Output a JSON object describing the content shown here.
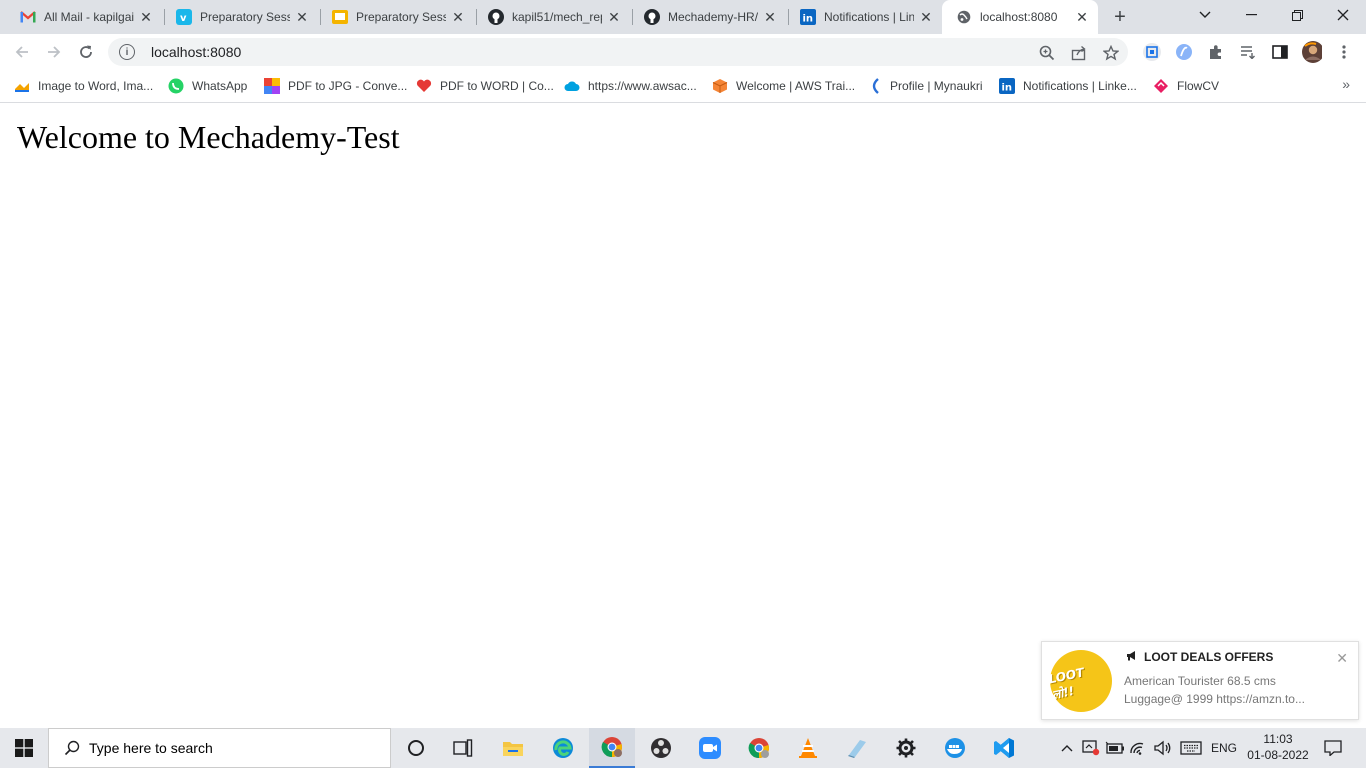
{
  "browser": {
    "tabs": [
      {
        "title": "All Mail - kapilgai",
        "icon": "gmail-icon"
      },
      {
        "title": "Preparatory Sessi",
        "icon": "vimeo-icon"
      },
      {
        "title": "Preparatory Sessi",
        "icon": "slides-icon"
      },
      {
        "title": "kapil51/mech_rep",
        "icon": "github-icon"
      },
      {
        "title": "Mechademy-HR/",
        "icon": "github-icon"
      },
      {
        "title": "Notifications | Lin",
        "icon": "linkedin-icon"
      },
      {
        "title": "localhost:8080",
        "icon": "globe-icon",
        "active": true
      }
    ],
    "url": "localhost:8080",
    "bookmarks": [
      {
        "label": "Image to Word, Ima...",
        "icon": "hand-icon"
      },
      {
        "label": "WhatsApp",
        "icon": "whatsapp-icon"
      },
      {
        "label": "PDF to JPG - Conve...",
        "icon": "colorgrid-icon"
      },
      {
        "label": "PDF to WORD | Co...",
        "icon": "heart-icon"
      },
      {
        "label": "https://www.awsac...",
        "icon": "cloud-icon"
      },
      {
        "label": "Welcome | AWS Trai...",
        "icon": "cube-icon"
      },
      {
        "label": "Profile | Mynaukri",
        "icon": "naukri-icon"
      },
      {
        "label": "Notifications | Linke...",
        "icon": "linkedin-icon"
      },
      {
        "label": "FlowCV",
        "icon": "flowcv-icon"
      }
    ]
  },
  "page": {
    "heading": "Welcome to Mechademy-Test"
  },
  "toast": {
    "logo_text": "LOOT लो!!",
    "title": "LOOT DEALS OFFERS",
    "line1": "American Tourister 68.5 cms",
    "line2": "Luggage@ 1999  https://amzn.to..."
  },
  "taskbar": {
    "search_placeholder": "Type here to search",
    "language": "ENG",
    "time": "11:03",
    "date": "01-08-2022"
  },
  "colors": {
    "chrome_bg": "#dee1e6",
    "accent": "#1a73e8",
    "loot_yellow": "#f5c518"
  }
}
